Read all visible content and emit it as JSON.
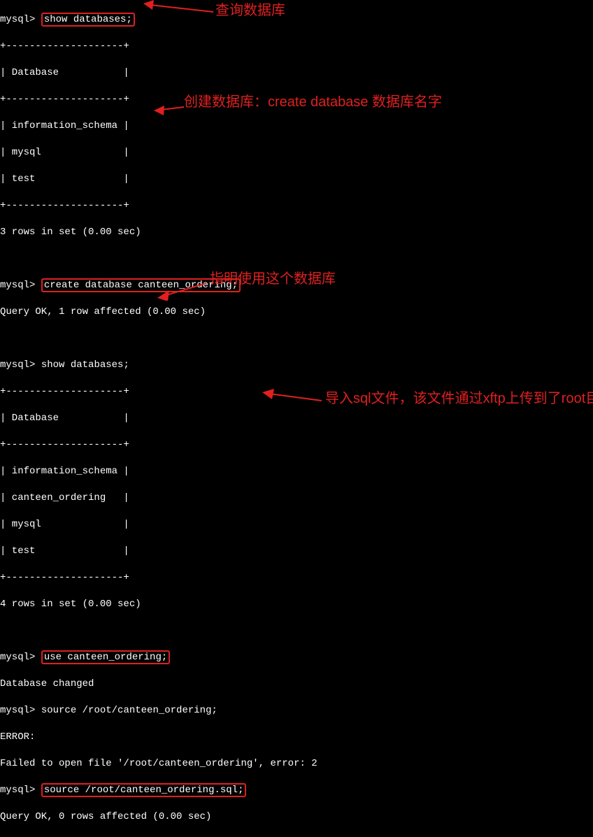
{
  "prompt": "mysql>",
  "commands": {
    "show_db1": "show databases;",
    "create_db": "create database canteen_ordering;",
    "show_db2": "show databases;",
    "use_db": "use canteen_ordering;",
    "source1": "source /root/canteen_ordering;",
    "source2": "source /root/canteen_ordering.sql;"
  },
  "output": {
    "border": "+--------------------+",
    "header": "| Database           |",
    "rows1": {
      "r1": "| information_schema |",
      "r2": "| mysql              |",
      "r3": "| test               |"
    },
    "rows2": {
      "r1": "| information_schema |",
      "r2": "| canteen_ordering   |",
      "r3": "| mysql              |",
      "r4": "| test               |"
    },
    "count1": "3 rows in set (0.00 sec)",
    "count2": "4 rows in set (0.00 sec)",
    "query_ok1": "Query OK, 1 row affected (0.00 sec)",
    "db_changed": "Database changed",
    "error": "ERROR:",
    "error_msg": "Failed to open file '/root/canteen_ordering', error: 2",
    "query_ok2": "Query OK, 0 rows affected (0.00 sec)"
  },
  "annotations": {
    "a1": "查询数据库",
    "a2": "创建数据库：create database 数据库名字",
    "a3": "指明使用这个数据库",
    "a4": "导入sql文件，该文件通过xftp上传到了root目录下了"
  }
}
